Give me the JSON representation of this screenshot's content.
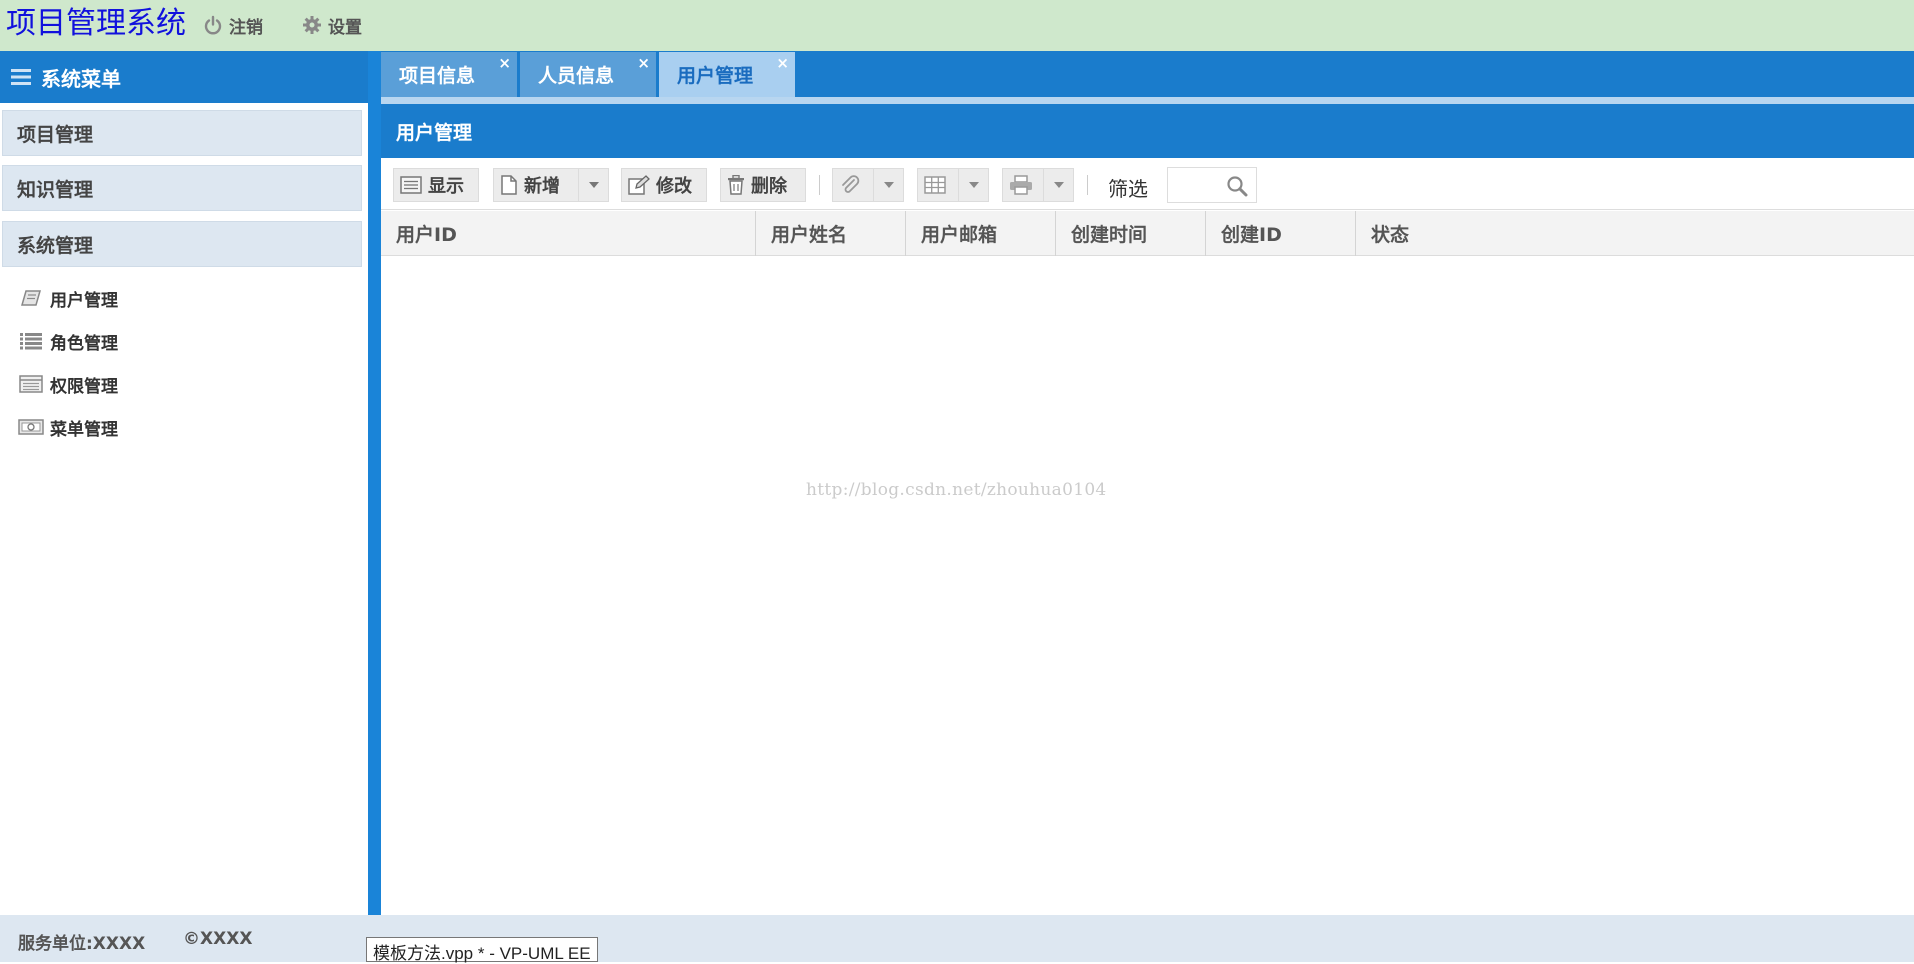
{
  "header": {
    "app_title": "项目管理系统",
    "logout_label": "注销",
    "settings_label": "设置"
  },
  "sidebar": {
    "title": "系统菜单",
    "panels": [
      {
        "label": "项目管理"
      },
      {
        "label": "知识管理"
      },
      {
        "label": "系统管理"
      }
    ],
    "sub_items": [
      {
        "label": "用户管理",
        "icon": "book-icon"
      },
      {
        "label": "角色管理",
        "icon": "list-icon"
      },
      {
        "label": "权限管理",
        "icon": "table-list-icon"
      },
      {
        "label": "菜单管理",
        "icon": "money-icon"
      }
    ]
  },
  "tabs": [
    {
      "label": "项目信息",
      "close": "×",
      "active": false
    },
    {
      "label": "人员信息",
      "close": "×",
      "active": false
    },
    {
      "label": "用户管理",
      "close": "×",
      "active": true
    }
  ],
  "panel": {
    "title": "用户管理"
  },
  "toolbar": {
    "show_label": "显示",
    "add_label": "新增",
    "edit_label": "修改",
    "delete_label": "删除",
    "filter_label": "筛选",
    "filter_value": ""
  },
  "grid": {
    "columns": [
      "用户ID",
      "用户姓名",
      "用户邮箱",
      "创建时间",
      "创建ID",
      "状态"
    ],
    "rows": []
  },
  "watermark": "http://blog.csdn.net/zhouhua0104",
  "footer": {
    "unit": "服务单位:XXXX",
    "copyright": "©XXXX"
  },
  "taskbar_tooltip": "模板方法.vpp * - VP-UML EE",
  "colors": {
    "header_bg": "#cfe8cc",
    "title_color": "#1111dd",
    "primary_blue": "#1a7ccc",
    "active_tab": "#a9cff0",
    "panel_bg": "#dde7f1"
  }
}
